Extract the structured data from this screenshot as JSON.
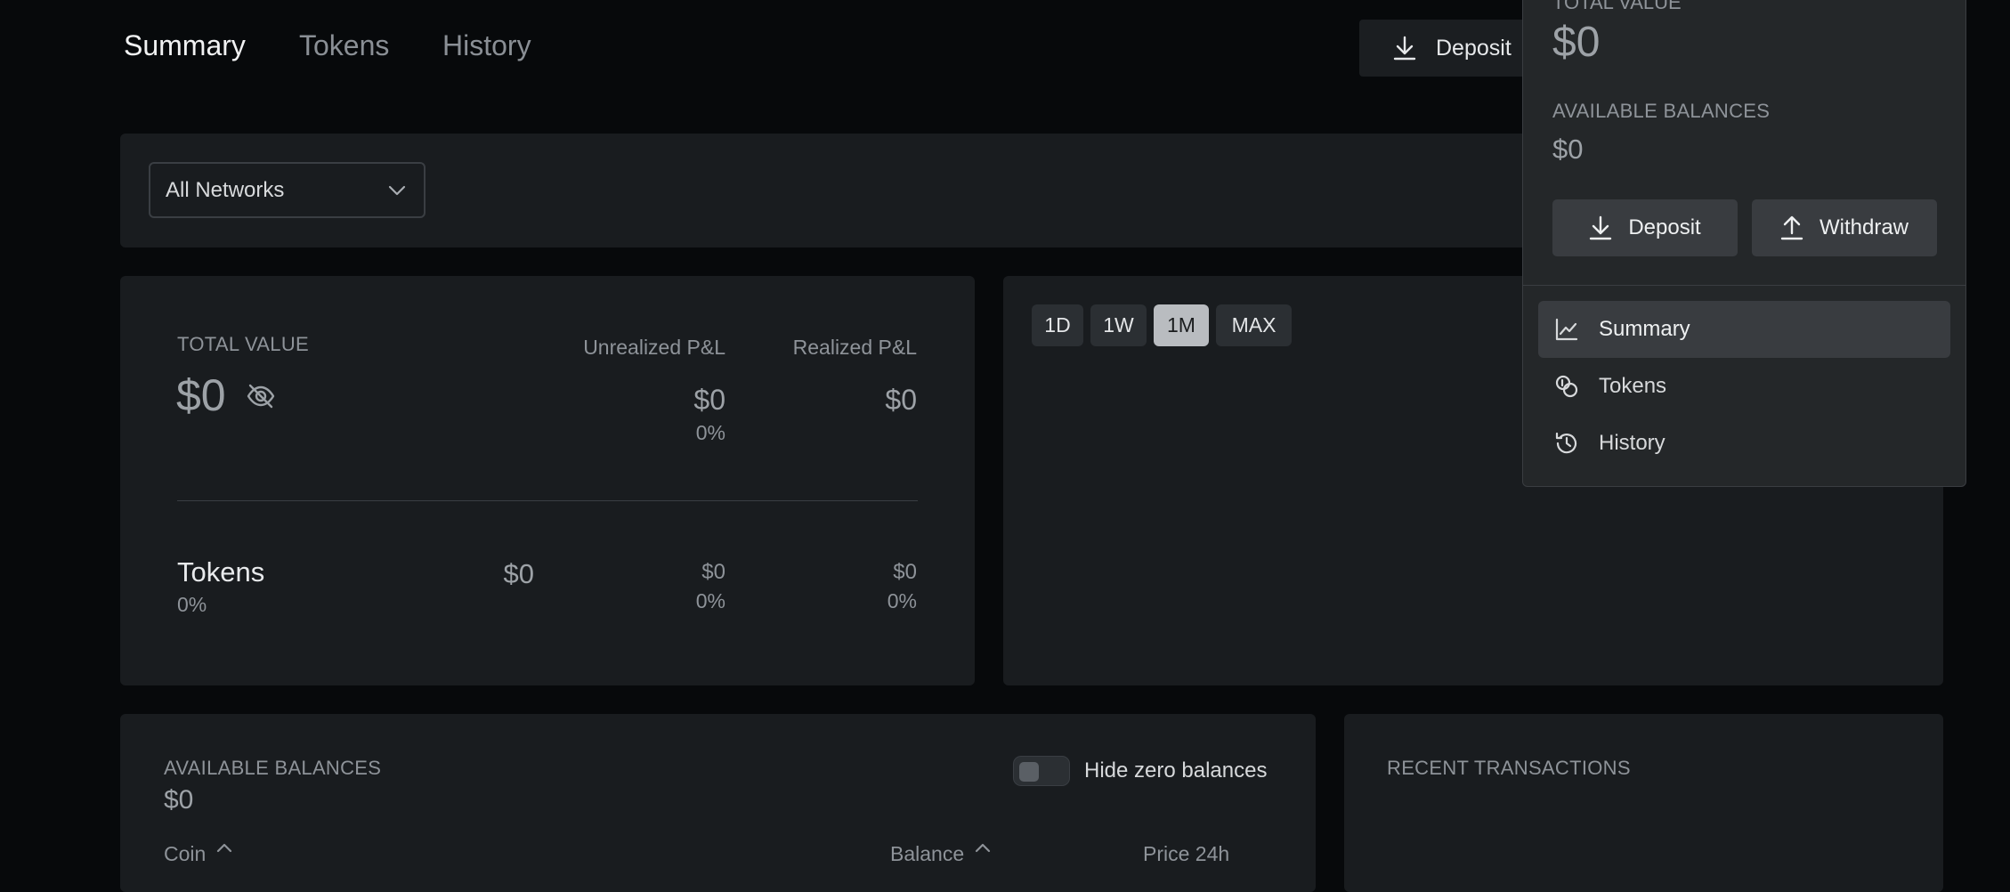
{
  "top_nav": {
    "tabs": [
      {
        "label": "Summary",
        "active": true
      },
      {
        "label": "Tokens",
        "active": false
      },
      {
        "label": "History",
        "active": false
      }
    ],
    "deposit_label": "Deposit"
  },
  "network_filter": {
    "selected": "All Networks"
  },
  "overview": {
    "total_value_label": "TOTAL VALUE",
    "total_value": "$0",
    "unrealized_label": "Unrealized P&L",
    "realized_label": "Realized P&L",
    "unrealized_value": "$0",
    "unrealized_pct": "0%",
    "realized_value": "$0",
    "tokens_row": {
      "name": "Tokens",
      "pct": "0%",
      "value": "$0",
      "unrealized_value": "$0",
      "unrealized_pct": "0%",
      "realized_value": "$0",
      "realized_pct": "0%"
    }
  },
  "chart": {
    "ranges": [
      {
        "label": "1D",
        "active": false
      },
      {
        "label": "1W",
        "active": false
      },
      {
        "label": "1M",
        "active": true
      },
      {
        "label": "MAX",
        "active": false
      }
    ]
  },
  "balances": {
    "title": "AVAILABLE BALANCES",
    "value": "$0",
    "hide_zero_label": "Hide zero balances",
    "hide_zero_on": false,
    "columns": [
      "Coin",
      "Balance",
      "Price 24h"
    ]
  },
  "recent_tx": {
    "title": "RECENT TRANSACTIONS"
  },
  "dropdown": {
    "total_value_label": "TOTAL VALUE",
    "total_value": "$0",
    "available_label": "AVAILABLE BALANCES",
    "available_value": "$0",
    "deposit_label": "Deposit",
    "withdraw_label": "Withdraw",
    "menu": [
      {
        "label": "Summary",
        "icon": "chart-line-icon",
        "active": true
      },
      {
        "label": "Tokens",
        "icon": "coins-icon",
        "active": false
      },
      {
        "label": "History",
        "icon": "history-icon",
        "active": false
      }
    ]
  },
  "colors": {
    "background": "#07090b",
    "card": "#191c1f",
    "panel": "#242729",
    "active_range": "#b9bcc0"
  }
}
